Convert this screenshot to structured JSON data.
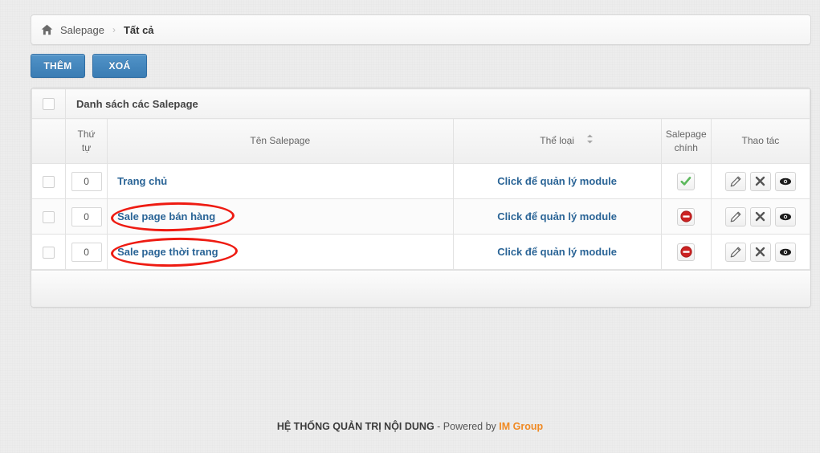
{
  "breadcrumb": {
    "home_icon": "home-icon",
    "root": "Salepage",
    "separator": "›",
    "current": "Tất cả"
  },
  "toolbar": {
    "add_label": "THÊM",
    "delete_label": "XOÁ"
  },
  "panel": {
    "title": "Danh sách các Salepage",
    "columns": {
      "order": "Thứ tự",
      "order_line1": "Thứ",
      "order_line2": "tự",
      "name": "Tên Salepage",
      "type": "Thể loại",
      "main_line1": "Salepage",
      "main_line2": "chính",
      "actions": "Thao tác",
      "sort_icon": "sort-updown-icon"
    },
    "rows": [
      {
        "order": "0",
        "name": "Trang chủ",
        "type": "Click để quản lý module",
        "main_state": "active",
        "main_icon": "check-icon",
        "annotated": false,
        "actions": [
          {
            "icon": "pencil-icon",
            "name": "edit-button"
          },
          {
            "icon": "x-icon",
            "name": "delete-button"
          },
          {
            "icon": "eye-icon",
            "name": "view-button"
          }
        ]
      },
      {
        "order": "0",
        "name": "Sale page bán hàng",
        "type": "Click để quản lý module",
        "main_state": "inactive",
        "main_icon": "no-entry-icon",
        "annotated": true,
        "actions": [
          {
            "icon": "pencil-icon",
            "name": "edit-button"
          },
          {
            "icon": "x-icon",
            "name": "delete-button"
          },
          {
            "icon": "eye-icon",
            "name": "view-button"
          }
        ]
      },
      {
        "order": "0",
        "name": "Sale page thời trang",
        "type": "Click để quản lý module",
        "main_state": "inactive",
        "main_icon": "no-entry-icon",
        "annotated": true,
        "actions": [
          {
            "icon": "pencil-icon",
            "name": "edit-button"
          },
          {
            "icon": "x-icon",
            "name": "delete-button"
          },
          {
            "icon": "eye-icon",
            "name": "view-button"
          }
        ]
      }
    ]
  },
  "footer": {
    "system": "HỆ THỐNG QUẢN TRỊ NỘI DUNG",
    "powered": " - Powered by ",
    "brand": "IM Group"
  },
  "colors": {
    "accent_blue": "#3a7cb3",
    "link_blue": "#2a6496",
    "success_green": "#5cb85c",
    "danger_red": "#cc2222",
    "annotation_red": "#ee1b12",
    "brand_orange": "#f08a24"
  }
}
